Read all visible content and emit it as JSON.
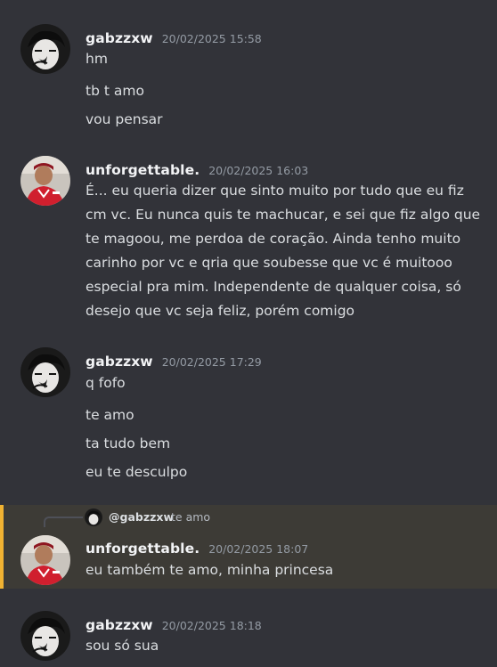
{
  "colors": {
    "background": "#323339",
    "mention_highlight": "#3d3b36",
    "mention_bar": "#f0b232",
    "author": "#f2f3f5",
    "timestamp": "#949ba4",
    "text": "#dbdee1"
  },
  "messages": [
    {
      "author": "gabzzxw",
      "avatar_icon": "bw-illustrated-avatar-icon",
      "timestamp": "20/02/2025 15:58",
      "lines": [
        "hm",
        "tb t amo",
        "vou pensar"
      ]
    },
    {
      "author": "unforgettable.",
      "avatar_icon": "red-jersey-photo-avatar-icon",
      "timestamp": "20/02/2025 16:03",
      "paragraph_lines": [
        "É... eu queria dizer que sinto muito por tudo que eu fiz",
        "cm vc. Eu nunca quis te machucar, e sei que fiz  algo que",
        "te magoou, me perdoa de coração. Ainda tenho muito",
        "carinho por vc e qria que soubesse que vc é muitooo",
        "especial pra mim. Independente de qualquer coisa, só",
        "desejo que vc seja feliz, porém comigo"
      ]
    },
    {
      "author": "gabzzxw",
      "avatar_icon": "bw-illustrated-avatar-icon",
      "timestamp": "20/02/2025 17:29",
      "lines": [
        "q fofo",
        "te amo",
        "ta tudo bem",
        "eu te desculpo"
      ]
    },
    {
      "author": "unforgettable.",
      "avatar_icon": "red-jersey-photo-avatar-icon",
      "timestamp": "20/02/2025 18:07",
      "reply": {
        "author": "@gabzzxw",
        "text": "te amo"
      },
      "lines": [
        "eu também te amo, minha princesa"
      ]
    },
    {
      "author": "gabzzxw",
      "avatar_icon": "bw-illustrated-avatar-icon",
      "timestamp": "20/02/2025 18:18",
      "lines": [
        "sou só sua"
      ]
    }
  ]
}
